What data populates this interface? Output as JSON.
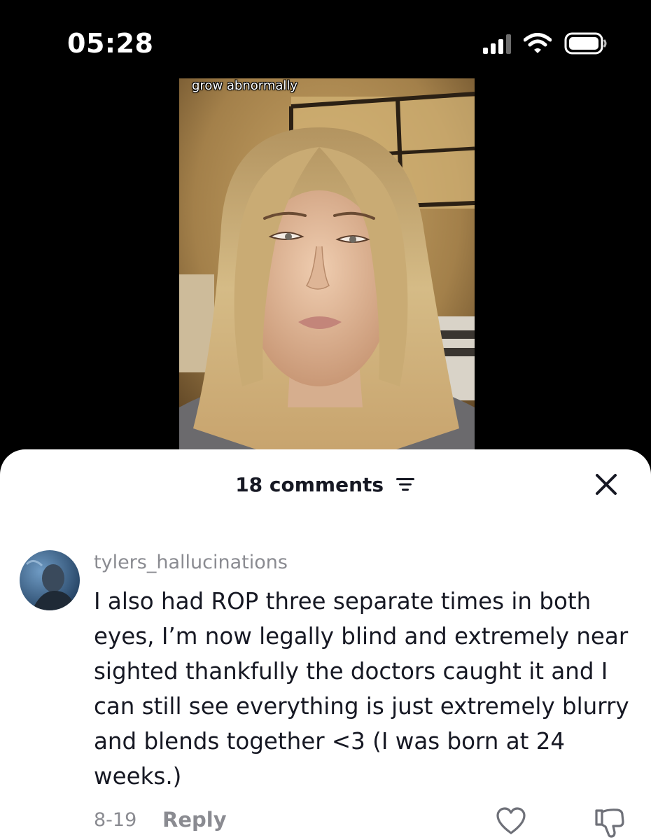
{
  "status_bar": {
    "time": "05:28"
  },
  "video": {
    "caption": "grow abnormally"
  },
  "comments_sheet": {
    "count_label": "18 comments",
    "comment": {
      "username": "tylers_hallucinations",
      "text": "I also had ROP three separate times in both eyes, I’m now legally blind and extremely near sighted thankfully the doctors caught it and I can still see everything is just extremely blurry and blends together <3 (I was born at 24 weeks.)",
      "date": "8-19",
      "reply_label": "Reply"
    }
  },
  "icons": {
    "signal": "cellular-signal-icon",
    "wifi": "wifi-icon",
    "battery": "battery-icon",
    "sort": "sort-filter-icon",
    "close": "close-icon",
    "like": "heart-icon",
    "dislike": "thumbs-down-icon"
  },
  "colors": {
    "sheet_background": "#ffffff",
    "primary_text": "#161823",
    "secondary_text": "#8a8b91",
    "status_bar_background": "#000000"
  }
}
